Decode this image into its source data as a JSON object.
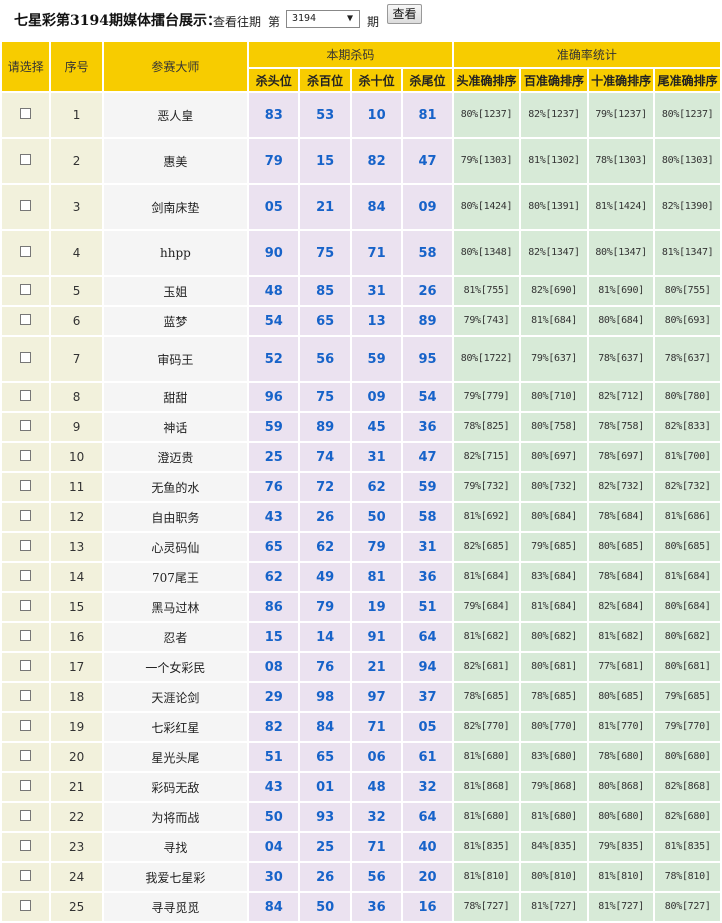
{
  "header": {
    "title": "七星彩第3194期媒体擂台展示：",
    "history_label": "查看往期",
    "di": "第",
    "period_value": "3194",
    "qi": "期",
    "view_button": "查看"
  },
  "table": {
    "col_select": "请选择",
    "col_index": "序号",
    "col_master": "参赛大师",
    "group_kill": "本期杀码",
    "group_stats": "准确率统计",
    "kill_cols": [
      "杀头位",
      "杀百位",
      "杀十位",
      "杀尾位"
    ],
    "stat_cols": [
      "头准确排序",
      "百准确排序",
      "十准确排序",
      "尾准确排序"
    ],
    "rows": [
      {
        "idx": "1",
        "name": "恶人皇",
        "kills": [
          "83",
          "53",
          "10",
          "81"
        ],
        "stats": [
          "80%[1237]",
          "82%[1237]",
          "79%[1237]",
          "80%[1237]"
        ]
      },
      {
        "idx": "2",
        "name": "惠美",
        "kills": [
          "79",
          "15",
          "82",
          "47"
        ],
        "stats": [
          "79%[1303]",
          "81%[1302]",
          "78%[1303]",
          "80%[1303]"
        ]
      },
      {
        "idx": "3",
        "name": "剑南床垫",
        "kills": [
          "05",
          "21",
          "84",
          "09"
        ],
        "stats": [
          "80%[1424]",
          "80%[1391]",
          "81%[1424]",
          "82%[1390]"
        ]
      },
      {
        "idx": "4",
        "name": "hhpp",
        "kills": [
          "90",
          "75",
          "71",
          "58"
        ],
        "stats": [
          "80%[1348]",
          "82%[1347]",
          "80%[1347]",
          "81%[1347]"
        ]
      },
      {
        "idx": "5",
        "name": "玉姐",
        "kills": [
          "48",
          "85",
          "31",
          "26"
        ],
        "stats": [
          "81%[755]",
          "82%[690]",
          "81%[690]",
          "80%[755]"
        ]
      },
      {
        "idx": "6",
        "name": "蓝梦",
        "kills": [
          "54",
          "65",
          "13",
          "89"
        ],
        "stats": [
          "79%[743]",
          "81%[684]",
          "80%[684]",
          "80%[693]"
        ]
      },
      {
        "idx": "7",
        "name": "审码王",
        "kills": [
          "52",
          "56",
          "59",
          "95"
        ],
        "stats": [
          "80%[1722]",
          "79%[637]",
          "78%[637]",
          "78%[637]"
        ]
      },
      {
        "idx": "8",
        "name": "甜甜",
        "kills": [
          "96",
          "75",
          "09",
          "54"
        ],
        "stats": [
          "79%[779]",
          "80%[710]",
          "82%[712]",
          "80%[780]"
        ]
      },
      {
        "idx": "9",
        "name": "神话",
        "kills": [
          "59",
          "89",
          "45",
          "36"
        ],
        "stats": [
          "78%[825]",
          "80%[758]",
          "78%[758]",
          "82%[833]"
        ]
      },
      {
        "idx": "10",
        "name": "澄迈贵",
        "kills": [
          "25",
          "74",
          "31",
          "47"
        ],
        "stats": [
          "82%[715]",
          "80%[697]",
          "78%[697]",
          "81%[700]"
        ]
      },
      {
        "idx": "11",
        "name": "无鱼的水",
        "kills": [
          "76",
          "72",
          "62",
          "59"
        ],
        "stats": [
          "79%[732]",
          "80%[732]",
          "82%[732]",
          "82%[732]"
        ]
      },
      {
        "idx": "12",
        "name": "自由职务",
        "kills": [
          "43",
          "26",
          "50",
          "58"
        ],
        "stats": [
          "81%[692]",
          "80%[684]",
          "78%[684]",
          "81%[686]"
        ]
      },
      {
        "idx": "13",
        "name": "心灵码仙",
        "kills": [
          "65",
          "62",
          "79",
          "31"
        ],
        "stats": [
          "82%[685]",
          "79%[685]",
          "80%[685]",
          "80%[685]"
        ]
      },
      {
        "idx": "14",
        "name": "707尾王",
        "kills": [
          "62",
          "49",
          "81",
          "36"
        ],
        "stats": [
          "81%[684]",
          "83%[684]",
          "78%[684]",
          "81%[684]"
        ]
      },
      {
        "idx": "15",
        "name": "黑马过林",
        "kills": [
          "86",
          "79",
          "19",
          "51"
        ],
        "stats": [
          "79%[684]",
          "81%[684]",
          "82%[684]",
          "80%[684]"
        ]
      },
      {
        "idx": "16",
        "name": "忍者",
        "kills": [
          "15",
          "14",
          "91",
          "64"
        ],
        "stats": [
          "81%[682]",
          "80%[682]",
          "81%[682]",
          "80%[682]"
        ]
      },
      {
        "idx": "17",
        "name": "一个女彩民",
        "kills": [
          "08",
          "76",
          "21",
          "94"
        ],
        "stats": [
          "82%[681]",
          "80%[681]",
          "77%[681]",
          "80%[681]"
        ]
      },
      {
        "idx": "18",
        "name": "天涯论剑",
        "kills": [
          "29",
          "98",
          "97",
          "37"
        ],
        "stats": [
          "78%[685]",
          "78%[685]",
          "80%[685]",
          "79%[685]"
        ]
      },
      {
        "idx": "19",
        "name": "七彩红星",
        "kills": [
          "82",
          "84",
          "71",
          "05"
        ],
        "stats": [
          "82%[770]",
          "80%[770]",
          "81%[770]",
          "79%[770]"
        ]
      },
      {
        "idx": "20",
        "name": "星光头尾",
        "kills": [
          "51",
          "65",
          "06",
          "61"
        ],
        "stats": [
          "81%[680]",
          "83%[680]",
          "78%[680]",
          "80%[680]"
        ]
      },
      {
        "idx": "21",
        "name": "彩码无敌",
        "kills": [
          "43",
          "01",
          "48",
          "32"
        ],
        "stats": [
          "81%[868]",
          "79%[868]",
          "80%[868]",
          "82%[868]"
        ]
      },
      {
        "idx": "22",
        "name": "为将而战",
        "kills": [
          "50",
          "93",
          "32",
          "64"
        ],
        "stats": [
          "81%[680]",
          "81%[680]",
          "80%[680]",
          "82%[680]"
        ]
      },
      {
        "idx": "23",
        "name": "寻找",
        "kills": [
          "04",
          "25",
          "71",
          "40"
        ],
        "stats": [
          "81%[835]",
          "84%[835]",
          "79%[835]",
          "81%[835]"
        ]
      },
      {
        "idx": "24",
        "name": "我爱七星彩",
        "kills": [
          "30",
          "26",
          "56",
          "20"
        ],
        "stats": [
          "81%[810]",
          "80%[810]",
          "81%[810]",
          "78%[810]"
        ]
      },
      {
        "idx": "25",
        "name": "寻寻觅觅",
        "kills": [
          "84",
          "50",
          "36",
          "16"
        ],
        "stats": [
          "78%[727]",
          "81%[727]",
          "81%[727]",
          "80%[727]"
        ]
      }
    ]
  }
}
